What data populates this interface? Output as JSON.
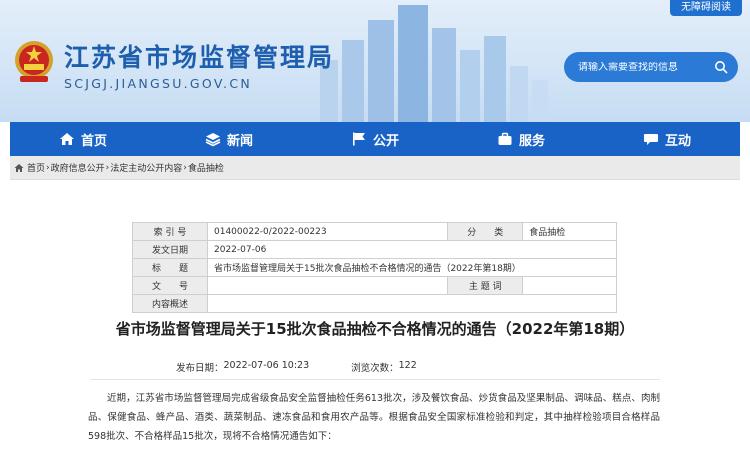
{
  "header": {
    "accessibility": "无障碍阅读",
    "site_title": "江苏省市场监督管理局",
    "site_domain": "SCJGJ.JIANGSU.GOV.CN",
    "search": {
      "placeholder": "请输入需要查找的信息"
    }
  },
  "nav": [
    {
      "label": "首页",
      "icon": "home-icon"
    },
    {
      "label": "新闻",
      "icon": "layers-icon"
    },
    {
      "label": "公开",
      "icon": "flag-icon"
    },
    {
      "label": "服务",
      "icon": "briefcase-icon"
    },
    {
      "label": "互动",
      "icon": "chat-icon"
    }
  ],
  "breadcrumb": [
    "首页",
    "政府信息公开",
    "法定主动公开内容",
    "食品抽检"
  ],
  "breadcrumb_sep": "›",
  "meta": {
    "index_no_label": "索 引 号",
    "index_no": "01400022-0/2022-00223",
    "category_label": "分　　类",
    "category": "食品抽检",
    "date_label": "发文日期",
    "date": "2022-07-06",
    "title_label": "标　　题",
    "title": "省市场监督管理局关于15批次食品抽检不合格情况的通告（2022年第18期）",
    "doc_no_label": "文　　号",
    "doc_no": "",
    "subject_label": "主 题 词",
    "subject": "",
    "summary_label": "内容概述",
    "summary": ""
  },
  "article": {
    "title": "省市场监督管理局关于15批次食品抽检不合格情况的通告（2022年第18期）",
    "pub_label": "发布日期：",
    "pub_time": "2022-07-06 10:23",
    "views_label": "浏览次数：",
    "views": "122",
    "body": "近期，江苏省市场监督管理局完成省级食品安全监督抽检任务613批次，涉及餐饮食品、炒货食品及坚果制品、调味品、糕点、肉制品、保健食品、蜂产品、酒类、蔬菜制品、速冻食品和食用农产品等。根据食品安全国家标准检验和判定，其中抽样检验项目合格样品598批次、不合格样品15批次，现将不合格情况通告如下："
  },
  "colors": {
    "nav_bg": "#1a63c6",
    "title_blue": "#1d5fae",
    "search_bg": "#2a7ad6"
  }
}
